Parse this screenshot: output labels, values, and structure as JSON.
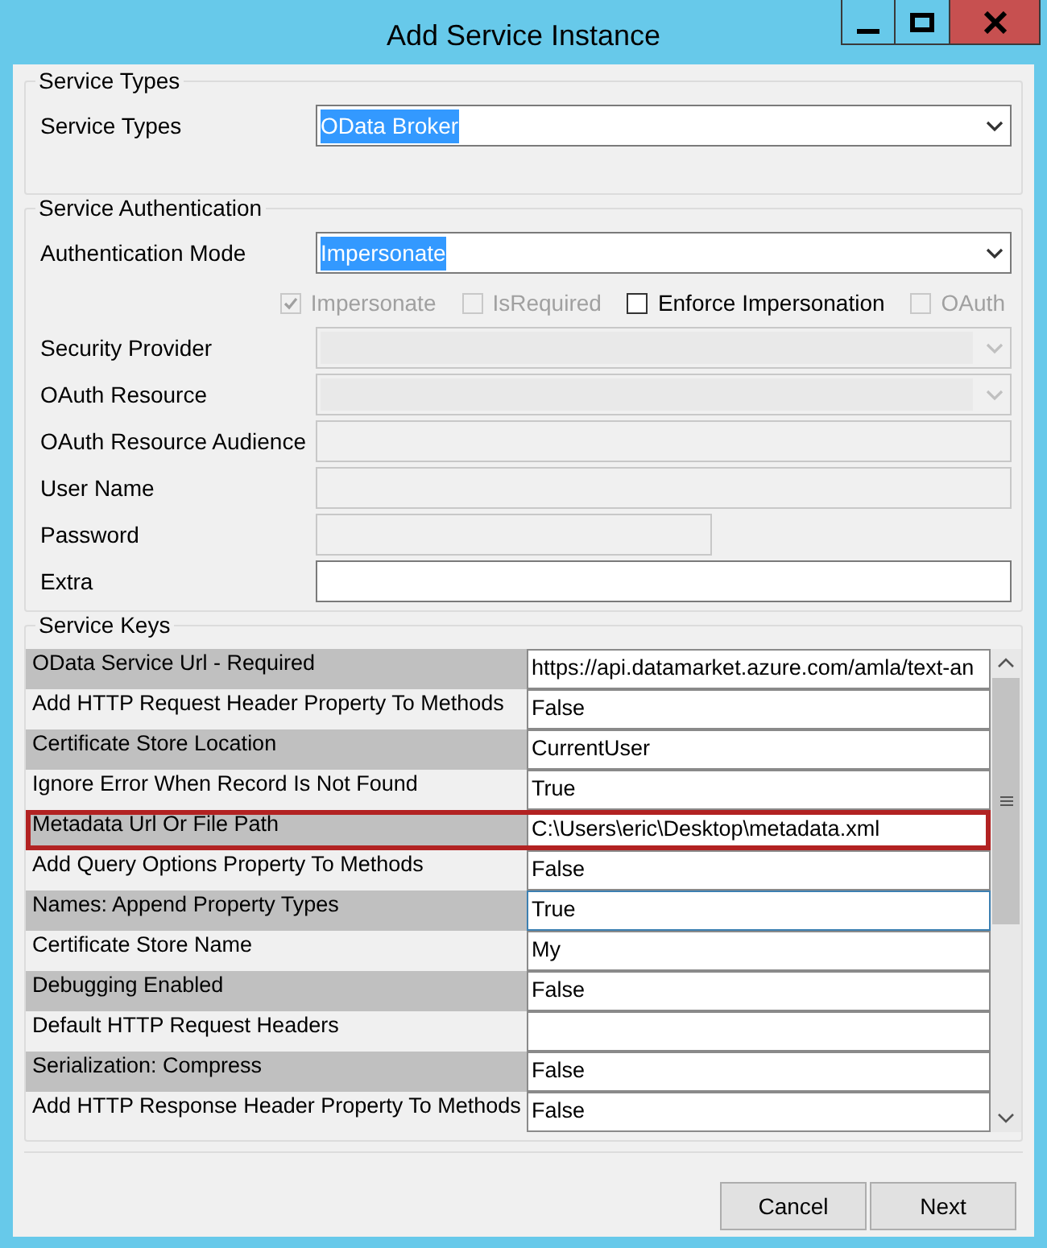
{
  "window": {
    "title": "Add Service Instance"
  },
  "service_types": {
    "title": "Service Types",
    "fields": [
      {
        "label": "Service Types",
        "kind": "dropdown",
        "value": "OData Broker",
        "text_selected": true,
        "disabled": false
      }
    ]
  },
  "service_authentication": {
    "title": "Service Authentication",
    "fields": [
      {
        "label": "Authentication Mode",
        "kind": "dropdown",
        "value": "Impersonate",
        "text_selected": true,
        "disabled": false
      },
      {
        "kind": "checkboxes",
        "options": [
          {
            "label": "Impersonate",
            "checked": true,
            "disabled": true
          },
          {
            "label": "IsRequired",
            "checked": false,
            "disabled": true
          },
          {
            "label": "Enforce Impersonation",
            "checked": false,
            "disabled": false
          },
          {
            "label": "OAuth",
            "checked": false,
            "disabled": true
          }
        ]
      },
      {
        "label": "Security Provider",
        "kind": "dropdown",
        "disabled": true
      },
      {
        "label": "OAuth Resource",
        "kind": "dropdown",
        "disabled": true
      },
      {
        "label": "OAuth Resource Audience",
        "kind": "text",
        "disabled": true
      },
      {
        "label": "User Name",
        "kind": "text",
        "disabled": true
      },
      {
        "label": "Password",
        "kind": "password",
        "disabled": true
      },
      {
        "label": "Extra",
        "kind": "text",
        "disabled": false
      }
    ]
  },
  "service_keys": {
    "title": "Service Keys",
    "rows": [
      {
        "name": "OData Service Url - Required",
        "value": "https://api.datamarket.azure.com/amla/text-an",
        "selected": false,
        "focused": false
      },
      {
        "name": "Add HTTP Request Header Property To Methods",
        "value": "False",
        "selected": false,
        "focused": false
      },
      {
        "name": "Certificate Store Location",
        "value": "CurrentUser",
        "selected": false,
        "focused": false
      },
      {
        "name": "Ignore Error When Record Is Not Found",
        "value": "True",
        "selected": false,
        "focused": false
      },
      {
        "name": "Metadata Url Or File Path",
        "value": "C:\\Users\\eric\\Desktop\\metadata.xml",
        "selected": true,
        "focused": false
      },
      {
        "name": "Add Query Options Property To Methods",
        "value": "False",
        "selected": false,
        "focused": false
      },
      {
        "name": "Names: Append Property Types",
        "value": "True",
        "selected": false,
        "focused": true
      },
      {
        "name": "Certificate Store Name",
        "value": "My",
        "selected": false,
        "focused": false
      },
      {
        "name": "Debugging Enabled",
        "value": "False",
        "selected": false,
        "focused": false
      },
      {
        "name": "Default HTTP Request Headers",
        "selected": false,
        "focused": false
      },
      {
        "name": "Serialization: Compress",
        "value": "False",
        "selected": false,
        "focused": false
      },
      {
        "name": "Add HTTP Response Header Property To Methods",
        "value": "False",
        "selected": false,
        "focused": false
      }
    ]
  },
  "buttons": [
    "Cancel",
    "Next"
  ]
}
